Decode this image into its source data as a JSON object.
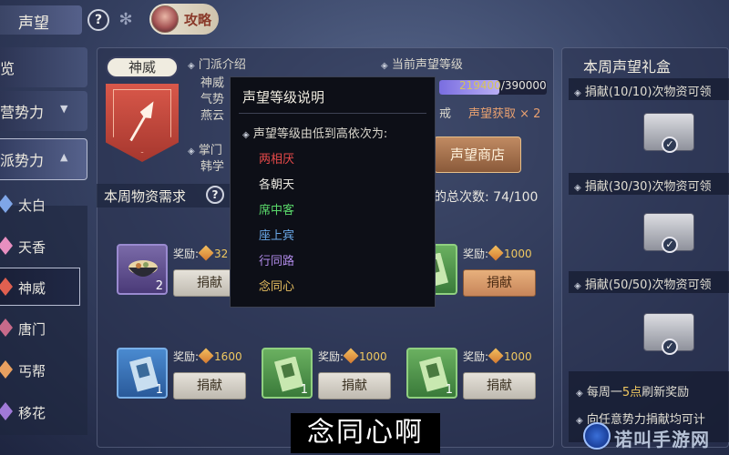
{
  "header": {
    "title": "声望",
    "help": "?",
    "guide_label": "攻略"
  },
  "nav": {
    "top_items": [
      {
        "label": "览"
      },
      {
        "label": "营势力",
        "arrow": "▼"
      },
      {
        "label": "派势力",
        "arrow": "▲"
      }
    ],
    "sect_items": [
      {
        "label": "太白",
        "color": "#7fa6e8"
      },
      {
        "label": "天香",
        "color": "#e88fc0"
      },
      {
        "label": "神威",
        "color": "#e06050",
        "active": true
      },
      {
        "label": "唐门",
        "color": "#c86a8a"
      },
      {
        "label": "丐帮",
        "color": "#e8a060"
      },
      {
        "label": "移花",
        "color": "#a07ad8"
      }
    ]
  },
  "faction": {
    "name": "神威",
    "intro_label": "门派介绍",
    "intro_lines": [
      "神威",
      "气势",
      "燕云"
    ],
    "leader_label": "掌门",
    "leader_name": "韩学",
    "current_label": "当前声望等级",
    "progress_current": "219400",
    "progress_total": "/390000",
    "progress_ratio": 0.5626,
    "obtain_prefix": "戒",
    "obtain_label": "声望获取 × 2",
    "shop_button": "声望商店"
  },
  "weekly": {
    "title": "本周物资需求",
    "help": "?",
    "count_label": "的总次数: 74/100",
    "items": [
      {
        "qty": "2",
        "reward_label": "奖励:",
        "reward_value": "32",
        "button": "捐献",
        "button_style": "grey",
        "kind": "food"
      },
      {
        "qty": "",
        "reward_label": "奖励:",
        "reward_value": "1000",
        "button": "捐献",
        "button_style": "orange",
        "kind": "green-scroll"
      },
      {
        "qty": "1",
        "reward_label": "奖励:",
        "reward_value": "1600",
        "button": "捐献",
        "button_style": "grey",
        "kind": "blue-scroll"
      },
      {
        "qty": "1",
        "reward_label": "奖励:",
        "reward_value": "1000",
        "button": "捐献",
        "button_style": "grey",
        "kind": "green-scroll"
      },
      {
        "qty": "1",
        "reward_label": "奖励:",
        "reward_value": "1000",
        "button": "捐献",
        "button_style": "grey",
        "kind": "green-scroll"
      }
    ]
  },
  "gift": {
    "title": "本周声望礼盒",
    "rows": [
      {
        "label": "捐献(10/10)次物资可领"
      },
      {
        "label": "捐献(30/30)次物资可领"
      },
      {
        "label": "捐献(50/50)次物资可领"
      }
    ],
    "footer": [
      {
        "pre": "每周一",
        "hl": "5点",
        "post": "刷新奖励"
      },
      {
        "pre": "向任意势力捐献均可计",
        "hl": "",
        "post": ""
      }
    ]
  },
  "popup": {
    "title": "声望等级说明",
    "desc": "声望等级由低到高依次为:",
    "ranks": [
      {
        "label": "两相厌",
        "color": "#e84a4a"
      },
      {
        "label": "各朝天",
        "color": "#e8e6df"
      },
      {
        "label": "席中客",
        "color": "#5ad86a"
      },
      {
        "label": "座上宾",
        "color": "#6aa8e8"
      },
      {
        "label": "行同路",
        "color": "#b08ae8"
      },
      {
        "label": "念同心",
        "color": "#e8c060"
      }
    ]
  },
  "subtitle": "念同心啊",
  "watermark": "诺叫手游网"
}
